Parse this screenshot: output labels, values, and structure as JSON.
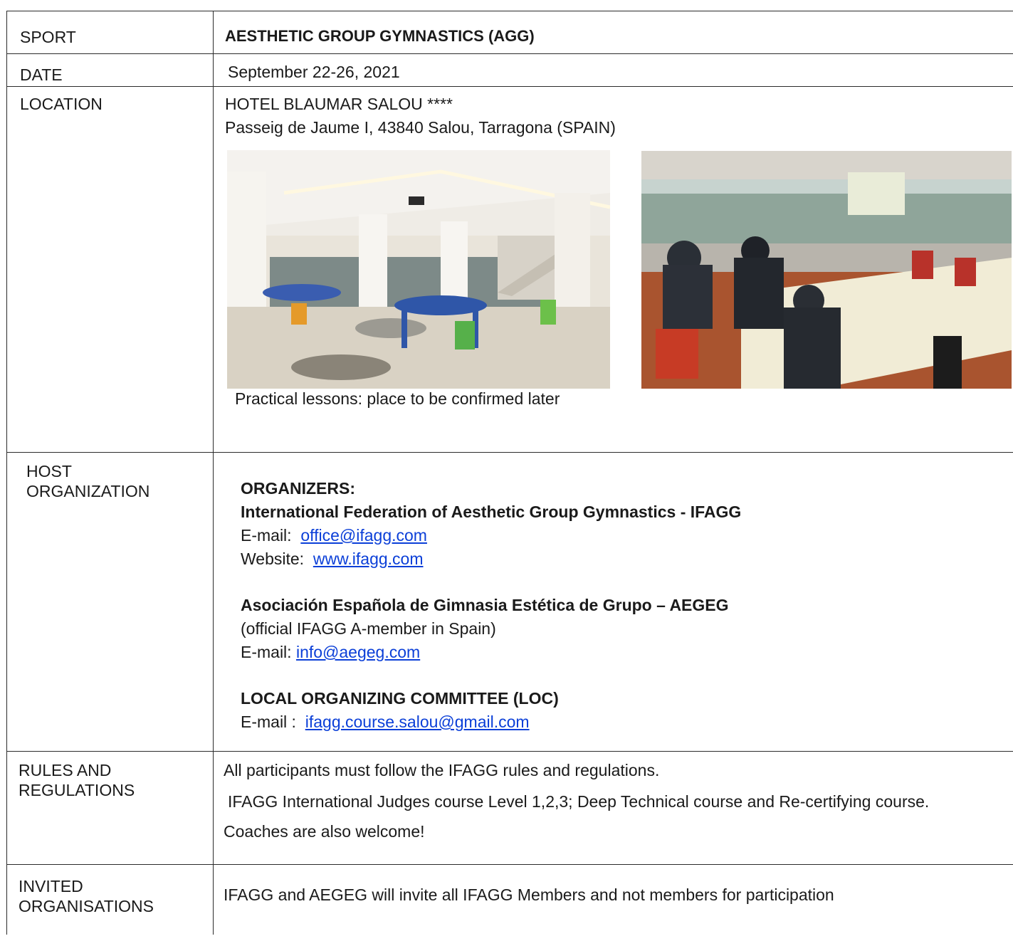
{
  "rows": {
    "sport": {
      "label": "SPORT",
      "value": "AESTHETIC GROUP GYMNASTICS (AGG)"
    },
    "date": {
      "label": "DATE",
      "value": "September 22-26, 2021"
    },
    "location": {
      "label": "LOCATION",
      "line1": "HOTEL BLAUMAR SALOU ****",
      "line2": "Passeig de Jaume I, 43840 Salou, Tarragona (SPAIN)",
      "caption": "Practical lessons: place to be confirmed later"
    },
    "host": {
      "label_line1": "HOST",
      "label_line2": "ORGANIZATION",
      "organizers_heading": "ORGANIZERS:",
      "ifagg_name": "International Federation of Aesthetic Group Gymnastics - IFAGG",
      "ifagg_email_prefix": "E-mail:",
      "ifagg_email": "office@ifagg.com",
      "ifagg_website_prefix": "Website:",
      "ifagg_website": "www.ifagg.com",
      "aegeg_name": "Asociación Española de Gimnasia Estética de Grupo – AEGEG",
      "aegeg_note": "(official IFAGG A-member in Spain)",
      "aegeg_email_prefix": "E-mail:",
      "aegeg_email": "info@aegeg.com",
      "loc_heading": "LOCAL ORGANIZING COMMITTEE (LOC)",
      "loc_email_prefix": "E-mail :",
      "loc_email": "ifagg.course.salou@gmail.com"
    },
    "rules": {
      "label_line1": "RULES AND",
      "label_line2": "REGULATIONS",
      "line1": "All participants must follow the IFAGG rules and regulations.",
      "line2": "IFAGG International Judges course Level 1,2,3; Deep Technical course and Re-certifying course.",
      "line3": "Coaches are also welcome!"
    },
    "invited": {
      "label_line1": "INVITED",
      "label_line2": "ORGANISATIONS",
      "value": "IFAGG and AEGEG will invite all IFAGG Members and not members for participation"
    }
  },
  "colors": {
    "link": "#0b3fd8",
    "border": "#2b2b2b",
    "text": "#1a1a1a"
  }
}
